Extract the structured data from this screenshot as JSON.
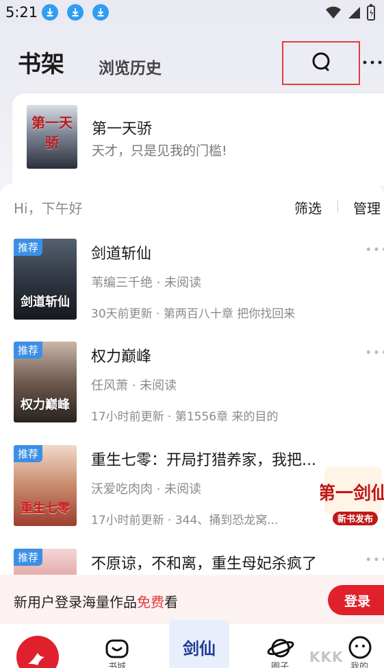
{
  "status_bar": {
    "time": "5:21",
    "download_icons": [
      "download-icon",
      "download-icon",
      "download-icon"
    ],
    "right_icons": [
      "wifi-icon",
      "signal-icon",
      "battery-icon"
    ]
  },
  "header": {
    "title": "书架",
    "history_tab": "浏览历史",
    "search_icon": "search-icon",
    "more_icon": "more-icon"
  },
  "recent": {
    "cover_text": "第一天骄",
    "title": "第一天骄",
    "subtitle": "天才，只是见我的门槛!"
  },
  "shelf": {
    "greeting": "Hi，下午好",
    "filter_label": "筛选",
    "manage_label": "管理",
    "books": [
      {
        "badge": "推荐",
        "cover_text": "剑道斩仙",
        "title": "剑道斩仙",
        "meta": "苇编三千绝 · 未阅读",
        "update": "30天前更新 · 第两百八十章  把你找回来"
      },
      {
        "badge": "推荐",
        "cover_text": "权力巅峰",
        "title": "权力巅峰",
        "meta": "任风萧 · 未阅读",
        "update": "17小时前更新 · 第1556章 来的目的"
      },
      {
        "badge": "推荐",
        "cover_text": "重生七零",
        "title": "重生七零：开局打猎养家，我把...",
        "meta": "沃爱吃肉肉 · 未阅读",
        "update": "17小时前更新 · 344、捅到恐龙窝..."
      },
      {
        "badge": "推荐",
        "cover_text": "",
        "title": "不原谅，不和离，重生母妃杀疯了",
        "meta": "",
        "update": ""
      }
    ]
  },
  "promo": {
    "title": "第一剑仙",
    "tag": "新书发布"
  },
  "login_banner": {
    "text_before": "新用户登录海量作品",
    "text_free": "免费",
    "text_after": "看",
    "button": "登录"
  },
  "bottom_nav": {
    "items": [
      {
        "label": "",
        "icon": "deer-logo-icon"
      },
      {
        "label": "书城",
        "icon": "bookstore-icon"
      },
      {
        "label": "",
        "icon": "promo-banner-icon"
      },
      {
        "label": "圈子",
        "icon": "planet-icon"
      },
      {
        "label": "我的",
        "icon": "profile-icon"
      }
    ]
  },
  "watermark": "KKK"
}
